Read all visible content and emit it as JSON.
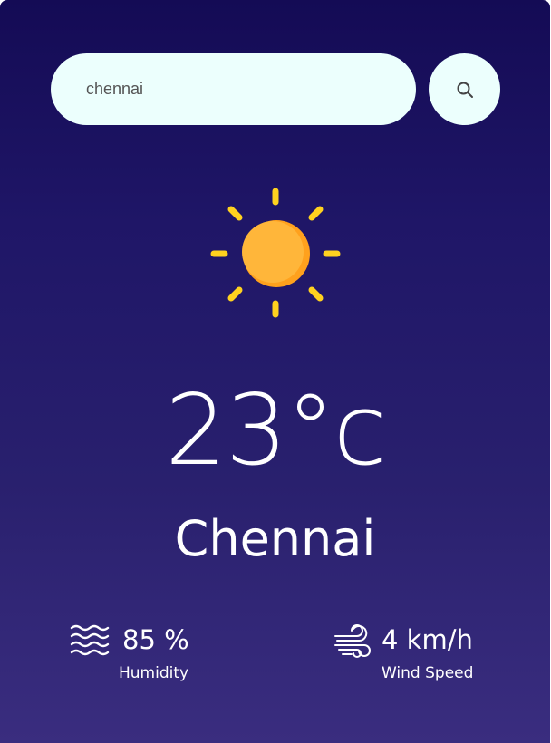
{
  "search": {
    "value": "chennai",
    "icon": "search-icon"
  },
  "weather": {
    "icon": "sun-icon",
    "temperature": "23°c",
    "city": "Chennai"
  },
  "stats": {
    "humidity": {
      "icon": "humidity-icon",
      "value": "85 %",
      "label": "Humidity"
    },
    "wind": {
      "icon": "wind-icon",
      "value": "4 km/h",
      "label": "Wind Speed"
    }
  },
  "colors": {
    "background_top": "#140b55",
    "background_bottom": "#3a2d7f",
    "search_bg": "#ecfffd",
    "sun": "#ffb133",
    "sun_rays": "#ffd21f",
    "text": "#ffffff"
  }
}
